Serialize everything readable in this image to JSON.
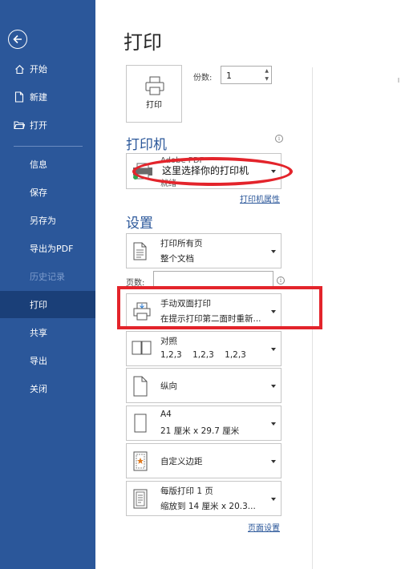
{
  "sidebar": {
    "items": [
      {
        "label": "开始",
        "icon": "home-icon"
      },
      {
        "label": "新建",
        "icon": "new-document-icon"
      },
      {
        "label": "打开",
        "icon": "open-folder-icon"
      },
      {
        "label": "信息"
      },
      {
        "label": "保存"
      },
      {
        "label": "另存为"
      },
      {
        "label": "导出为PDF"
      },
      {
        "label": "历史记录",
        "disabled": true
      },
      {
        "label": "打印",
        "active": true
      },
      {
        "label": "共享"
      },
      {
        "label": "导出"
      },
      {
        "label": "关闭"
      }
    ]
  },
  "main": {
    "title": "打印",
    "print_button_label": "打印",
    "copies": {
      "label": "份数:",
      "value": "1"
    },
    "printer": {
      "heading": "打印机",
      "name": "Adobe PDF",
      "status": "就绪",
      "overlay_text": "这里选择你的打印机",
      "properties_link": "打印机属性"
    },
    "settings": {
      "heading": "设置",
      "pages_label": "页数:",
      "dropdowns": [
        {
          "line1": "打印所有页",
          "line2": "整个文档",
          "icon": "document-pages-icon"
        },
        {
          "line1": "手动双面打印",
          "line2": "在提示打印第二面时重新...",
          "icon": "manual-duplex-icon"
        },
        {
          "line1": "对照",
          "line2": "1,2,3    1,2,3    1,2,3",
          "icon": "collate-icon"
        },
        {
          "line1": "纵向",
          "line2": "",
          "icon": "portrait-icon"
        },
        {
          "line1": "A4",
          "line2": "21 厘米 x 29.7 厘米",
          "icon": "paper-size-icon"
        },
        {
          "line1": "自定义边距",
          "line2": "",
          "icon": "margins-icon"
        },
        {
          "line1": "每版打印 1 页",
          "line2": "缩放到 14 厘米 x 20.3...",
          "icon": "pages-per-sheet-icon"
        }
      ],
      "page_setup_link": "页面设置"
    }
  },
  "colors": {
    "sidebar_bg": "#2b579a",
    "sidebar_active": "#1a3f78",
    "accent": "#2b579a",
    "annotation_red": "#e3242b"
  }
}
